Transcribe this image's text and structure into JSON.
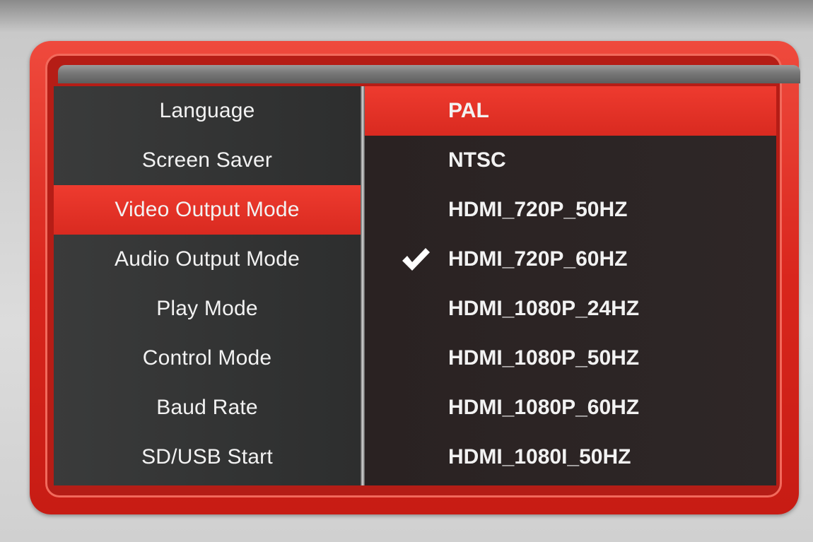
{
  "settings_menu": {
    "items": [
      {
        "label": "Language"
      },
      {
        "label": "Screen Saver"
      },
      {
        "label": "Video Output Mode"
      },
      {
        "label": "Audio Output Mode"
      },
      {
        "label": "Play Mode"
      },
      {
        "label": "Control Mode"
      },
      {
        "label": "Baud Rate"
      },
      {
        "label": "SD/USB Start"
      }
    ],
    "selected_item": "Video Output Mode"
  },
  "video_output_options": {
    "items": [
      {
        "label": "PAL"
      },
      {
        "label": "NTSC"
      },
      {
        "label": "HDMI_720P_50HZ"
      },
      {
        "label": "HDMI_720P_60HZ"
      },
      {
        "label": "HDMI_1080P_24HZ"
      },
      {
        "label": "HDMI_1080P_50HZ"
      },
      {
        "label": "HDMI_1080P_60HZ"
      },
      {
        "label": "HDMI_1080I_50HZ"
      }
    ],
    "highlighted_item": "PAL",
    "checked_item": "HDMI_720P_60HZ",
    "check_icon": "checkmark-icon"
  },
  "colors": {
    "accent_red": "#e0291f",
    "panel_dark": "#2d2e2e",
    "text": "#f2f2f2"
  }
}
